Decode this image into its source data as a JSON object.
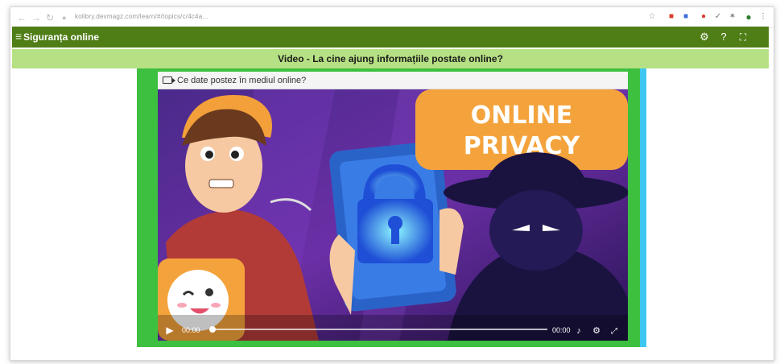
{
  "browser": {
    "url_text": "kolibry.devmagz.com/learn/#/topics/c/4c4a..."
  },
  "app": {
    "title": "Siguranța online",
    "menu_icon": "hamburger-icon",
    "settings_icon": "gear-icon",
    "help_icon": "help-circle-icon",
    "fullscreen_icon": "fullscreen-icon"
  },
  "lesson": {
    "title": "Video - La cine ajung informațiile postate online?"
  },
  "video": {
    "header_title": "Ce date postez în mediul online?",
    "thumbnail_text_line1": "ONLINE",
    "thumbnail_text_line2": "PRIVACY",
    "current_time": "00:00",
    "duration": "00:00",
    "progress": 0
  },
  "colors": {
    "app_bar": "#4f7d16",
    "sub_bar": "#b6e084",
    "stage_green": "#3dbf3f",
    "stage_cyan": "#3ec7f0",
    "privacy_orange": "#f4a33c"
  }
}
